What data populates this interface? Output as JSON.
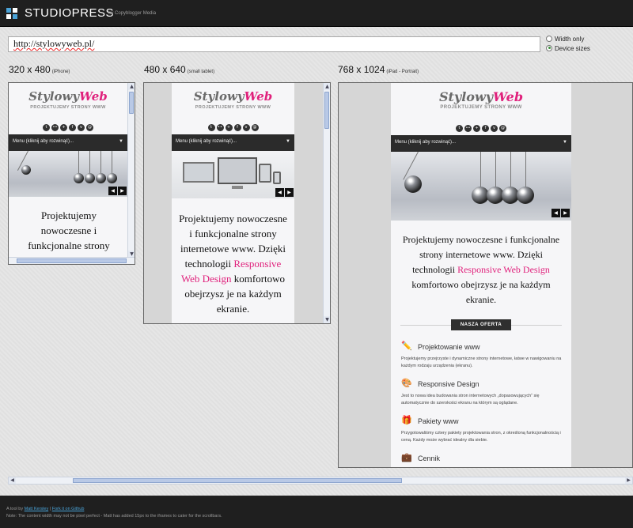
{
  "brand": {
    "name": "STUDIOPRESS",
    "tagline": "by Copyblogger Media"
  },
  "url_bar": {
    "value": "http://stylowyweb.pl/"
  },
  "view_options": [
    {
      "label": "Width only",
      "selected": false
    },
    {
      "label": "Device sizes",
      "selected": true
    }
  ],
  "devices": [
    {
      "size": "320 x 480",
      "name": "(iPhone)"
    },
    {
      "size": "480 x 640",
      "name": "(small tablet)"
    },
    {
      "size": "768 x 1024",
      "name": "(iPad - Portrait)"
    }
  ],
  "site": {
    "logo_a": "Stylowy",
    "logo_b": "Web",
    "sub": "PROJEKTUJEMY STRONY WWW",
    "menu": "Menu (kliknij aby rozwinąć)...",
    "headline_phone": "Projektujemy nowoczesne i funkcjonalne strony",
    "headline_pre": "Projektujemy nowoczesne i funkcjonalne strony internetowe www. Dzięki technologii",
    "headline_link": "Responsive Web Design",
    "headline_post": "komfortowo obejrzysz je na każdym ekranie.",
    "offer_button": "NASZA OFERTA",
    "sections": [
      {
        "title": "Projektowanie www",
        "text": "Projektujemy przejrzyste i dynamiczne strony internetowe, łatwe w nawigowaniu na każdym rodzaju urządzenia (ekranu)."
      },
      {
        "title": "Responsive Design",
        "text": "Jest to nowa idea budowania stron internetowych „dopasowujących” się automatycznie do szerokości ekranu na którym są oglądane."
      },
      {
        "title": "Pakiety www",
        "text": "Przygotowaliśmy cztery pakiety projektowania stron, z określoną funkcjonalnością i ceną. Każdy może wybrać idealny dla siebie."
      },
      {
        "title": "Cennik",
        "text": ""
      }
    ]
  },
  "footer": {
    "prefix": "A tool by",
    "author": "Matt Kersley",
    "sep": "|",
    "fork": "Fork it on Github",
    "note": "Note: The content width may not be pixel perfect - Matt has added 15px to the iframes to cater for the scrollbars."
  },
  "colors": {
    "accent": "#e0217c",
    "link": "#4aa3d8",
    "bar": "#1f1f1f"
  }
}
